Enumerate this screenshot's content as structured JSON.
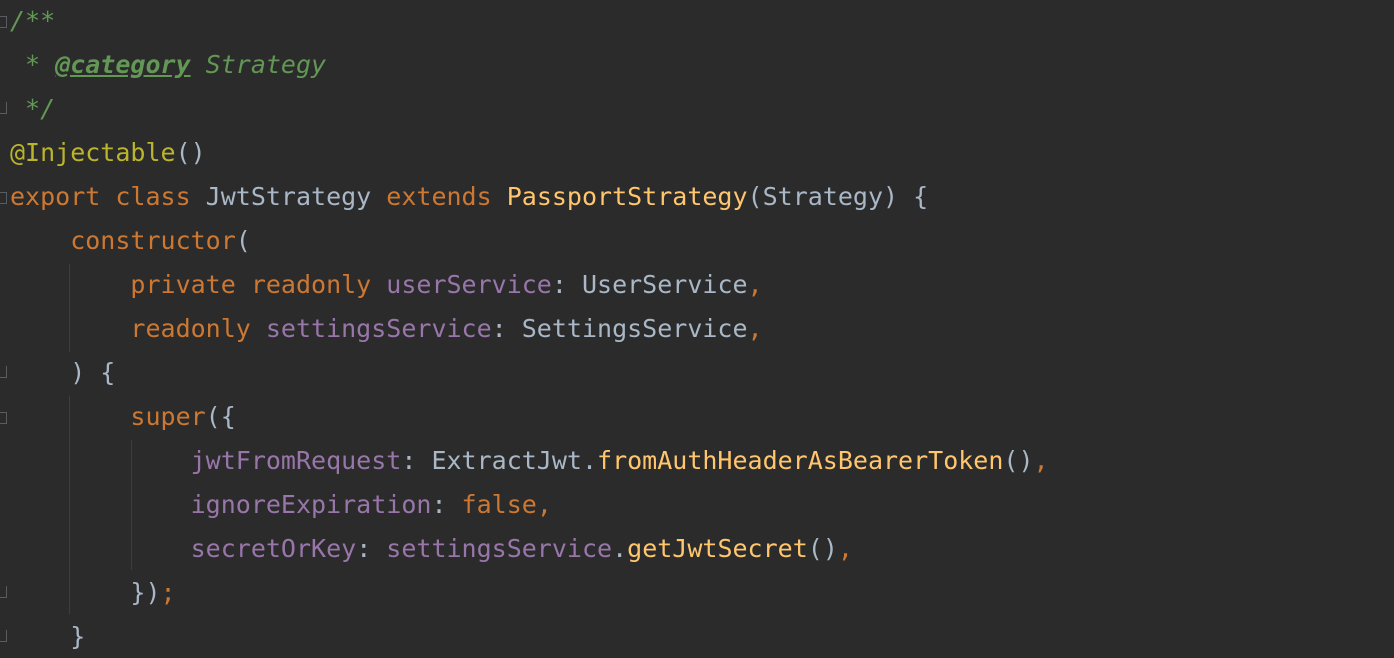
{
  "editor": {
    "background": "#2b2b2b",
    "lines": [
      {
        "tokens": [
          {
            "text": "/**",
            "kind": "doc"
          }
        ]
      },
      {
        "tokens": [
          {
            "text": " * ",
            "kind": "doc"
          },
          {
            "text": "@category",
            "kind": "doctag"
          },
          {
            "text": " Strategy",
            "kind": "doc"
          }
        ]
      },
      {
        "tokens": [
          {
            "text": " */",
            "kind": "doc"
          }
        ]
      },
      {
        "tokens": [
          {
            "text": "@Injectable",
            "kind": "ann"
          },
          {
            "text": "()",
            "kind": "plain"
          }
        ]
      },
      {
        "tokens": [
          {
            "text": "export class ",
            "kind": "kw"
          },
          {
            "text": "JwtStrategy ",
            "kind": "type"
          },
          {
            "text": "extends ",
            "kind": "kw"
          },
          {
            "text": "PassportStrategy",
            "kind": "fn"
          },
          {
            "text": "(Strategy) {",
            "kind": "plain"
          }
        ]
      },
      {
        "tokens": [
          {
            "text": "    constructor",
            "kind": "kw"
          },
          {
            "text": "(",
            "kind": "plain"
          }
        ]
      },
      {
        "tokens": [
          {
            "text": "        private readonly ",
            "kind": "kw"
          },
          {
            "text": "userService",
            "kind": "prop"
          },
          {
            "text": ": UserService",
            "kind": "plain"
          },
          {
            "text": ",",
            "kind": "kw"
          }
        ]
      },
      {
        "tokens": [
          {
            "text": "        readonly ",
            "kind": "kw"
          },
          {
            "text": "settingsService",
            "kind": "prop"
          },
          {
            "text": ": SettingsService",
            "kind": "plain"
          },
          {
            "text": ",",
            "kind": "kw"
          }
        ]
      },
      {
        "tokens": [
          {
            "text": "    ) {",
            "kind": "plain"
          }
        ]
      },
      {
        "tokens": [
          {
            "text": "        super",
            "kind": "kw"
          },
          {
            "text": "({",
            "kind": "plain"
          }
        ]
      },
      {
        "tokens": [
          {
            "text": "            jwtFromRequest",
            "kind": "prop"
          },
          {
            "text": ": ExtractJwt.",
            "kind": "plain"
          },
          {
            "text": "fromAuthHeaderAsBearerToken",
            "kind": "fn"
          },
          {
            "text": "()",
            "kind": "plain"
          },
          {
            "text": ",",
            "kind": "kw"
          }
        ]
      },
      {
        "tokens": [
          {
            "text": "            ignoreExpiration",
            "kind": "prop"
          },
          {
            "text": ": ",
            "kind": "plain"
          },
          {
            "text": "false",
            "kind": "kw"
          },
          {
            "text": ",",
            "kind": "kw"
          }
        ]
      },
      {
        "tokens": [
          {
            "text": "            secretOrKey",
            "kind": "prop"
          },
          {
            "text": ": ",
            "kind": "plain"
          },
          {
            "text": "settingsService",
            "kind": "prop"
          },
          {
            "text": ".",
            "kind": "plain"
          },
          {
            "text": "getJwtSecret",
            "kind": "fn"
          },
          {
            "text": "()",
            "kind": "plain"
          },
          {
            "text": ",",
            "kind": "kw"
          }
        ]
      },
      {
        "tokens": [
          {
            "text": "        })",
            "kind": "plain"
          },
          {
            "text": ";",
            "kind": "kw"
          }
        ]
      },
      {
        "tokens": [
          {
            "text": "    }",
            "kind": "plain"
          }
        ]
      }
    ]
  }
}
